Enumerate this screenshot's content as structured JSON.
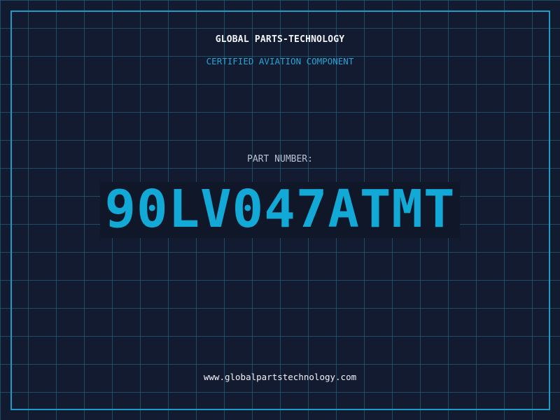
{
  "header": {
    "brand": "GLOBAL PARTS-TECHNOLOGY",
    "tagline": "CERTIFIED AVIATION COMPONENT"
  },
  "part": {
    "label": "PART NUMBER:",
    "number": "90LV047ATMT"
  },
  "footer": {
    "url": "www.globalpartstechnology.com"
  },
  "colors": {
    "background": "#121b30",
    "grid": "#26748e",
    "frame": "#1e9cc7",
    "accent": "#12a9d6",
    "text": "#f2f4f8",
    "muted": "#b8c2d0"
  }
}
